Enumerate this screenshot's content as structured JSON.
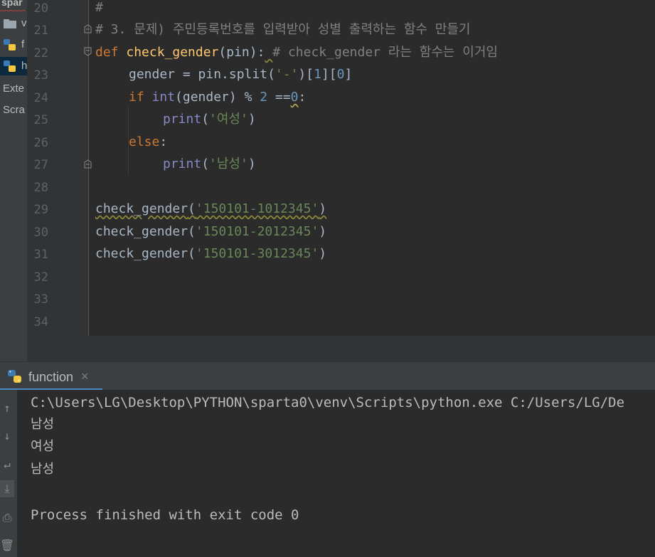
{
  "sidebar": {
    "project_name": "spar",
    "items": [
      {
        "label": "v",
        "icon": "folder-icon"
      },
      {
        "label": "f",
        "icon": "python-file-icon"
      },
      {
        "label": "h",
        "icon": "python-file-icon"
      },
      {
        "label": "Exte",
        "icon": ""
      },
      {
        "label": "Scra",
        "icon": ""
      }
    ]
  },
  "editor": {
    "line_numbers": [
      "20",
      "21",
      "22",
      "23",
      "24",
      "25",
      "26",
      "27",
      "28",
      "29",
      "30",
      "31",
      "32",
      "33",
      "34"
    ],
    "lines": {
      "l20": "#",
      "l21": "# 3. 문제) 주민등록번호를 입력받아 성별 출력하는 함수 만들기",
      "l22_def": "def ",
      "l22_name": "check_gender",
      "l22_params": "(pin):",
      "l22_space": " ",
      "l22_comment": "# check_gender 라는 함수는 이거임",
      "l23_a": "gender = pin.split(",
      "l23_str": "'-'",
      "l23_b": ")[",
      "l23_n1": "1",
      "l23_c": "][",
      "l23_n2": "0",
      "l23_d": "]",
      "l24_if": "if ",
      "l24_int": "int",
      "l24_a": "(gender) % ",
      "l24_n": "2",
      "l24_b": " ==",
      "l24_zero": "0",
      "l24_c": ":",
      "l25_print": "print",
      "l25_a": "(",
      "l25_str": "'여성'",
      "l25_b": ")",
      "l26_else": "else",
      "l26_colon": ":",
      "l27_print": "print",
      "l27_a": "(",
      "l27_str": "'남성'",
      "l27_b": ")",
      "l29_call": "check_gender",
      "l29_a": "(",
      "l29_str": "'150101-1012345'",
      "l29_b": ")",
      "l30_call": "check_gender",
      "l30_a": "(",
      "l30_str": "'150101-2012345'",
      "l30_b": ")",
      "l31_call": "check_gender",
      "l31_a": "(",
      "l31_str": "'150101-3012345'",
      "l31_b": ")"
    }
  },
  "run_panel": {
    "tab_label": "function",
    "close_glyph": "×",
    "output": [
      "C:\\Users\\LG\\Desktop\\PYTHON\\sparta0\\venv\\Scripts\\python.exe C:/Users/LG/De",
      "남성",
      "여성",
      "남성",
      "",
      "Process finished with exit code 0"
    ],
    "toolbar": [
      {
        "icon": "arrow-up-icon",
        "glyph": "↑"
      },
      {
        "icon": "arrow-down-icon",
        "glyph": "↓"
      },
      {
        "icon": "soft-wrap-icon",
        "glyph": "↵"
      },
      {
        "icon": "scroll-to-end-icon",
        "glyph": "⤓"
      },
      {
        "icon": "print-icon",
        "glyph": "⎙"
      },
      {
        "icon": "trash-icon",
        "glyph": "🗑"
      }
    ]
  },
  "colors": {
    "background": "#2b2b2b",
    "keyword": "#cc7832",
    "function": "#ffc66d",
    "string": "#6a8759",
    "number": "#6897bb",
    "comment": "#808080",
    "builtin": "#8888c6",
    "default": "#a9b7c6"
  }
}
